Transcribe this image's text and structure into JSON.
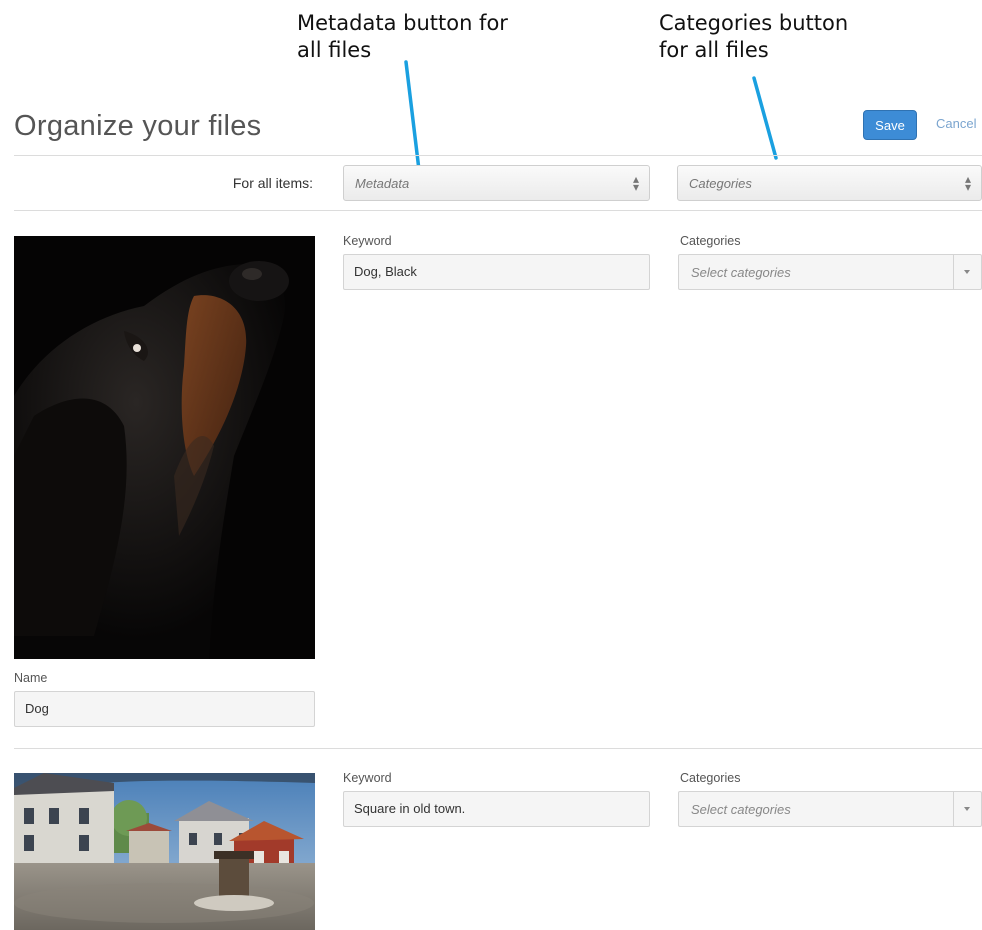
{
  "annotations": {
    "metadata_callout": [
      "Metadata button for",
      "all files"
    ],
    "categories_callout": [
      "Categories button",
      "for all files"
    ],
    "arrow_color": "#1aa0e0"
  },
  "header": {
    "title": "Organize your files",
    "save_label": "Save",
    "cancel_label": "Cancel",
    "accent_color": "#3d8cd6"
  },
  "bulk_row": {
    "label": "For all items:",
    "metadata_select": {
      "placeholder": "Metadata"
    },
    "categories_select": {
      "placeholder": "Categories"
    }
  },
  "items": [
    {
      "image_icon": "dog-photo",
      "keyword_label": "Keyword",
      "keyword_value": "Dog, Black",
      "categories_label": "Categories",
      "categories_placeholder": "Select categories",
      "name_label": "Name",
      "name_value": "Dog"
    },
    {
      "image_icon": "old-town-square-photo",
      "keyword_label": "Keyword",
      "keyword_value": "Square in old town.",
      "categories_label": "Categories",
      "categories_placeholder": "Select categories"
    }
  ]
}
